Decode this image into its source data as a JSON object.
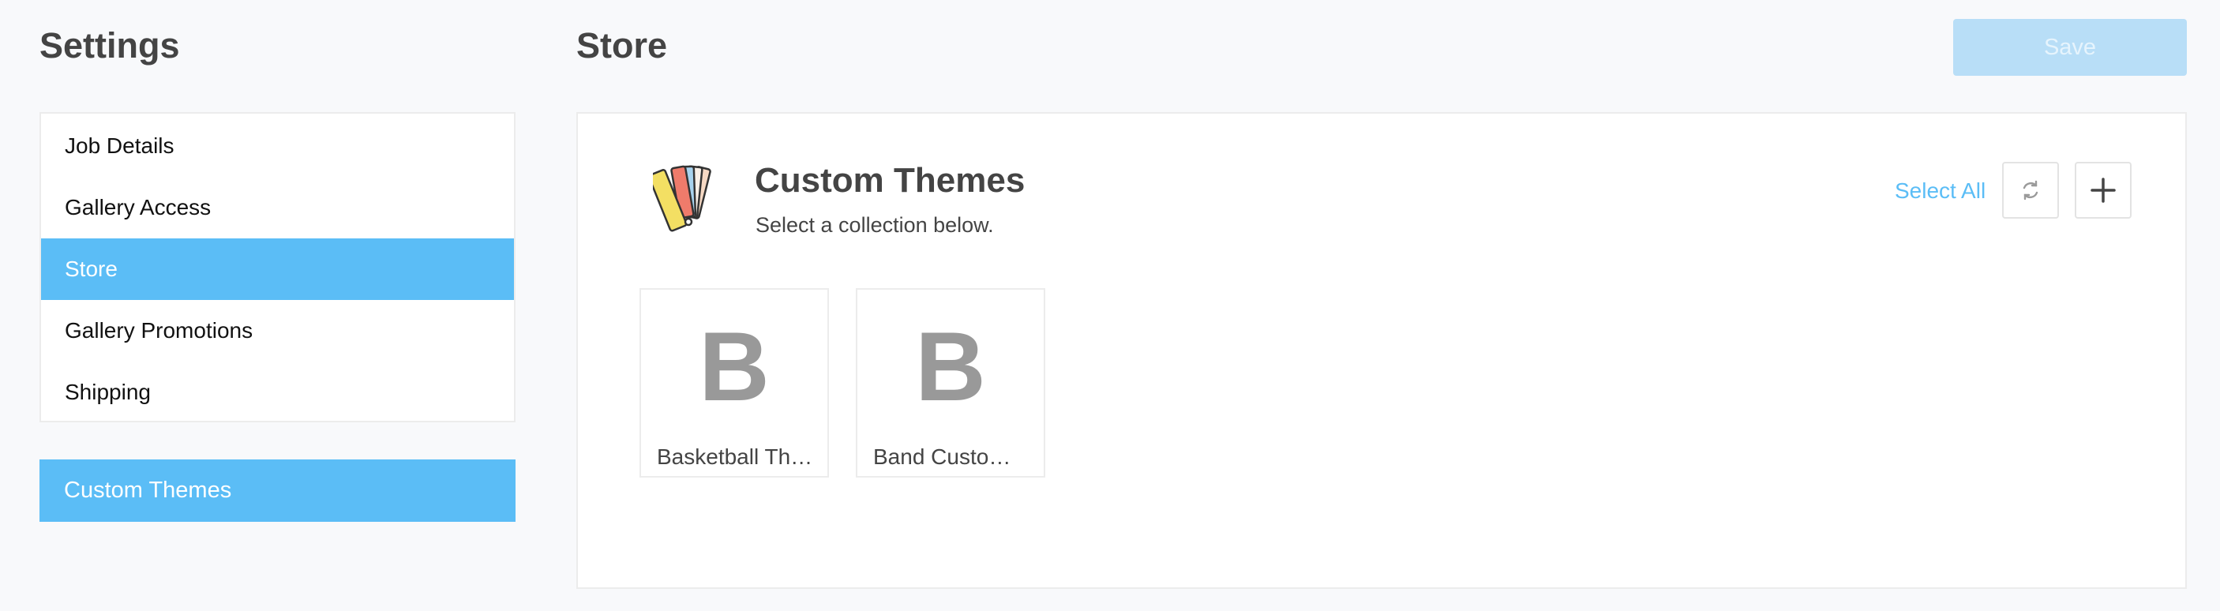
{
  "sidebar": {
    "title": "Settings",
    "items": [
      {
        "label": "Job Details"
      },
      {
        "label": "Gallery Access"
      },
      {
        "label": "Store"
      },
      {
        "label": "Gallery Promotions"
      },
      {
        "label": "Shipping"
      }
    ],
    "active_index": 2,
    "secondary_button": "Custom Themes"
  },
  "header": {
    "title": "Store",
    "save_label": "Save"
  },
  "panel": {
    "icon": "color-swatch-icon",
    "title": "Custom Themes",
    "subtitle": "Select a collection below.",
    "select_all_label": "Select All",
    "refresh_icon": "refresh-icon",
    "add_icon": "plus-icon",
    "collections": [
      {
        "letter": "B",
        "label": "Basketball Th…"
      },
      {
        "letter": "B",
        "label": "Band Custo…"
      }
    ]
  },
  "colors": {
    "accent": "#5bbdf6",
    "save_disabled": "#b8def7",
    "text": "#444444",
    "tile_letter": "#999999"
  }
}
